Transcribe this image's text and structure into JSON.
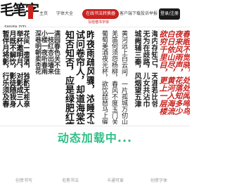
{
  "header": {
    "logo_text": "毛笔字",
    "logo_sub": "SHUFA ZITI",
    "nav": [
      {
        "label": "主页"
      },
      {
        "label": "字体大全"
      },
      {
        "label": "在线书法转换器"
      },
      {
        "label": "客户端下载"
      },
      {
        "label": "投诉举报"
      }
    ],
    "active_sub": "写经楷书字体",
    "login_label": "登录/注册"
  },
  "calligraphy": {
    "block1": [
      "花间一壶酒，独酌无相亲",
      "举杯邀明月，对影成三人",
      "月既不解饮，影徒随我身",
      "暂伴月将影，行乐须及春"
    ],
    "block2": [
      "满园春色关不住",
      "一枝红杏出墙来",
      "小楼一夜听春雨",
      "深巷明朝卖杏花",
      "春风又绿江南岸"
    ],
    "block3": [
      "昨夜雨疏风骤，浓睡不消残酒",
      "试问卷帘人，却道海棠依旧",
      "知否知否，应是绿肥红瘦"
    ],
    "block4": [
      "黄河远上白云间，一片孤城万仞山",
      "羌笛何须怨杨柳，春风不度玉门关",
      "葡萄美酒夜光杯，欲饮琵琶马上催"
    ],
    "block5": [
      "海内存知己，天涯若比邻",
      "无为在歧路，儿女共沾巾",
      "城阙辅三秦，风烟望五津"
    ],
    "block6": [
      "春眠不觉晓，处处闻啼鸟",
      "夜来风雨声，花落知多少",
      "白日依山尽，黄河入海流",
      "欲穷千里目，更上一层楼"
    ]
  },
  "loading_text": "动态加载中...",
  "tabs": [
    {
      "label": "创意书写"
    },
    {
      "label": "毛笔书法"
    },
    {
      "label": "卡通可爱"
    },
    {
      "label": "创意字体"
    }
  ],
  "colors": {
    "accent": "#c8221f",
    "loading": "#2ebf86",
    "ink": "#111111"
  }
}
